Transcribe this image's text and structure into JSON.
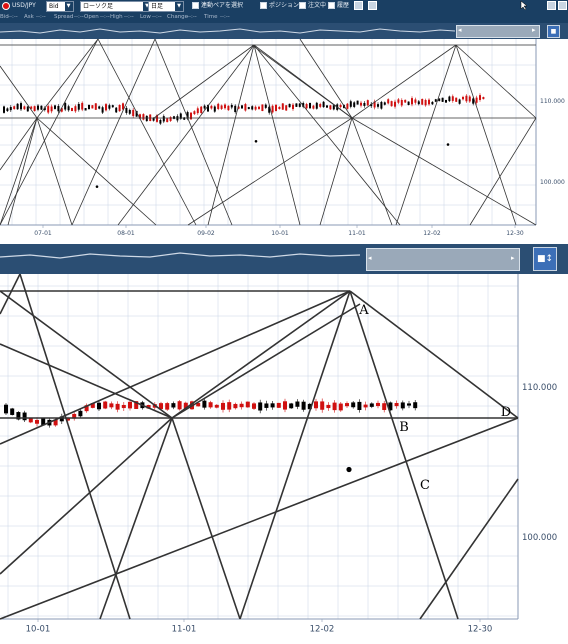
{
  "toolbar": {
    "symbol": "USD/JPY",
    "price_type": "Bid",
    "chart_type": "ローソク足",
    "timeframe": "日足",
    "link_pair": "連動ペアを選択",
    "position": "ポジション",
    "orders": "注文中",
    "history": "履歴"
  },
  "info_labels": [
    "Bid",
    "Ask",
    "Spread",
    "Open",
    "High",
    "Low",
    "Change",
    "Time"
  ],
  "info_value": "--:--",
  "colors": {
    "header": "#1a3f63",
    "navigator": "#2b4e73",
    "up_candle": "#d01010",
    "down_candle": "#000000",
    "grid": "#c8d3e6"
  },
  "top_chart": {
    "x_ticks": [
      "07-01",
      "08-01",
      "09-02",
      "10-01",
      "11-01",
      "12-02",
      "12-30"
    ],
    "y_ticks": [
      "110.000",
      "100.000"
    ]
  },
  "bottom_chart": {
    "x_ticks": [
      "10-01",
      "11-01",
      "12-02",
      "12-30"
    ],
    "y_ticks": [
      "110.000",
      "100.000"
    ],
    "annotations": [
      "A",
      "B",
      "C",
      "D"
    ]
  },
  "chart_data": {
    "type": "candlestick",
    "symbol": "USD/JPY",
    "timeframe": "日足",
    "ylim": [
      96,
      118
    ],
    "y_ticks": [
      100,
      110
    ],
    "price_band_approx": [
      107,
      110
    ],
    "markers": [
      {
        "x": "12-10",
        "y": 104.5
      },
      {
        "x": "10-06",
        "y": 104.9
      },
      {
        "x": "08-03",
        "y": 99.3
      }
    ]
  }
}
